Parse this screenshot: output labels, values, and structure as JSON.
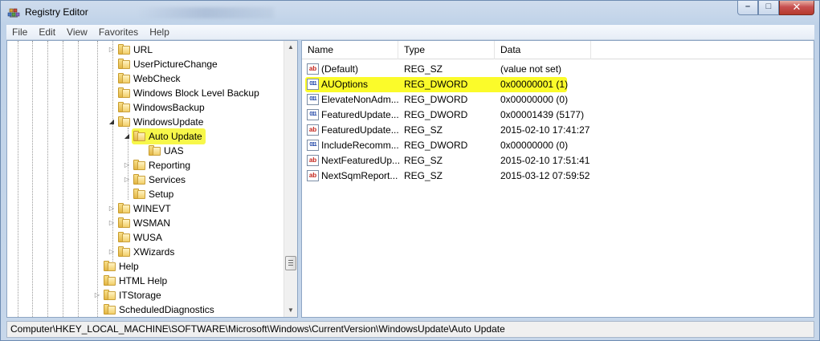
{
  "window": {
    "title": "Registry Editor"
  },
  "menu": [
    "File",
    "Edit",
    "View",
    "Favorites",
    "Help"
  ],
  "tree": [
    {
      "label": "URL",
      "depth": 1,
      "expander": "closed"
    },
    {
      "label": "UserPictureChange",
      "depth": 1,
      "expander": "none"
    },
    {
      "label": "WebCheck",
      "depth": 1,
      "expander": "none"
    },
    {
      "label": "Windows Block Level Backup",
      "depth": 1,
      "expander": "none"
    },
    {
      "label": "WindowsBackup",
      "depth": 1,
      "expander": "none"
    },
    {
      "label": "WindowsUpdate",
      "depth": 1,
      "expander": "open"
    },
    {
      "label": "Auto Update",
      "depth": 2,
      "expander": "open",
      "selected": true
    },
    {
      "label": "UAS",
      "depth": 3,
      "expander": "none"
    },
    {
      "label": "Reporting",
      "depth": 2,
      "expander": "closed"
    },
    {
      "label": "Services",
      "depth": 2,
      "expander": "closed"
    },
    {
      "label": "Setup",
      "depth": 2,
      "expander": "none"
    },
    {
      "label": "WINEVT",
      "depth": 1,
      "expander": "closed"
    },
    {
      "label": "WSMAN",
      "depth": 1,
      "expander": "closed"
    },
    {
      "label": "WUSA",
      "depth": 1,
      "expander": "none"
    },
    {
      "label": "XWizards",
      "depth": 1,
      "expander": "closed"
    },
    {
      "label": "Help",
      "depth": 0,
      "expander": "none"
    },
    {
      "label": "HTML Help",
      "depth": 0,
      "expander": "none"
    },
    {
      "label": "ITStorage",
      "depth": 0,
      "expander": "closed"
    },
    {
      "label": "ScheduledDiagnostics",
      "depth": 0,
      "expander": "none"
    }
  ],
  "list": {
    "columns": [
      "Name",
      "Type",
      "Data"
    ],
    "rows": [
      {
        "icon": "sz",
        "name": "(Default)",
        "type": "REG_SZ",
        "data": "(value not set)"
      },
      {
        "icon": "dw",
        "name": "AUOptions",
        "type": "REG_DWORD",
        "data": "0x00000001 (1)",
        "highlighted": true
      },
      {
        "icon": "dw",
        "name": "ElevateNonAdm...",
        "type": "REG_DWORD",
        "data": "0x00000000 (0)"
      },
      {
        "icon": "dw",
        "name": "FeaturedUpdate...",
        "type": "REG_DWORD",
        "data": "0x00001439 (5177)"
      },
      {
        "icon": "sz",
        "name": "FeaturedUpdate...",
        "type": "REG_SZ",
        "data": "2015-02-10 17:41:27"
      },
      {
        "icon": "dw",
        "name": "IncludeRecomm...",
        "type": "REG_DWORD",
        "data": "0x00000000 (0)"
      },
      {
        "icon": "sz",
        "name": "NextFeaturedUp...",
        "type": "REG_SZ",
        "data": "2015-02-10 17:51:41"
      },
      {
        "icon": "sz",
        "name": "NextSqmReport...",
        "type": "REG_SZ",
        "data": "2015-03-12 07:59:52"
      }
    ]
  },
  "icons": {
    "sz": "ab",
    "dw": "011\n110"
  },
  "status": "Computer\\HKEY_LOCAL_MACHINE\\SOFTWARE\\Microsoft\\Windows\\CurrentVersion\\WindowsUpdate\\Auto Update",
  "colors": {
    "highlight": "#fbfb2a",
    "accent": "#6d8bb1"
  }
}
